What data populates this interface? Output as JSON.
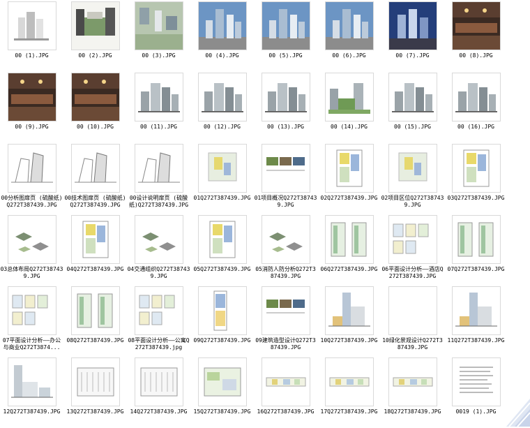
{
  "files": [
    {
      "name": "00 (1).JPG",
      "kind": "white-towers"
    },
    {
      "name": "00 (2).JPG",
      "kind": "plaza"
    },
    {
      "name": "00 (3).JPG",
      "kind": "aerial"
    },
    {
      "name": "00 (4).JPG",
      "kind": "towers-sky"
    },
    {
      "name": "00 (5).JPG",
      "kind": "towers-sky"
    },
    {
      "name": "00 (6).JPG",
      "kind": "towers-sky"
    },
    {
      "name": "00 (7).JPG",
      "kind": "towers-dusk"
    },
    {
      "name": "00 (8).JPG",
      "kind": "interior"
    },
    {
      "name": "00 (9).JPG",
      "kind": "interior"
    },
    {
      "name": "00 (10).JPG",
      "kind": "interior"
    },
    {
      "name": "00 (11).JPG",
      "kind": "grey-towers"
    },
    {
      "name": "00 (12).JPG",
      "kind": "grey-towers"
    },
    {
      "name": "00 (13).JPG",
      "kind": "grey-towers"
    },
    {
      "name": "00 (14).JPG",
      "kind": "green-towers"
    },
    {
      "name": "00 (15).JPG",
      "kind": "grey-towers"
    },
    {
      "name": "00 (16).JPG",
      "kind": "grey-towers"
    },
    {
      "name": "00分析图扉页 (硫酸纸)Q272T387439.JPG",
      "kind": "sketch"
    },
    {
      "name": "00技术图扉页 (硫酸纸)Q272T387439.JPG",
      "kind": "sketch"
    },
    {
      "name": "00设计说明扉页 (硫酸纸)Q272T387439.JPG",
      "kind": "sketch"
    },
    {
      "name": "01Q272T387439.JPG",
      "kind": "siteplan"
    },
    {
      "name": "01项目概况Q272T387439.JPG",
      "kind": "photos"
    },
    {
      "name": "02Q272T387439.JPG",
      "kind": "floorplan"
    },
    {
      "name": "02项目区位Q272T387439.JPG",
      "kind": "siteplan"
    },
    {
      "name": "03Q272T387439.JPG",
      "kind": "floorplan"
    },
    {
      "name": "03总体布局Q272T387439.JPG",
      "kind": "axon"
    },
    {
      "name": "04Q272T387439.JPG",
      "kind": "floorplan"
    },
    {
      "name": "04交通组织Q272T387439.JPG",
      "kind": "axon"
    },
    {
      "name": "05Q272T387439.JPG",
      "kind": "floorplan"
    },
    {
      "name": "05消防人防分析Q272T387439.JPG",
      "kind": "axon"
    },
    {
      "name": "06Q272T387439.JPG",
      "kind": "twoplans"
    },
    {
      "name": "06平面设计分析——酒店Q272T387439.JPG",
      "kind": "planset"
    },
    {
      "name": "07Q272T387439.JPG",
      "kind": "twoplans"
    },
    {
      "name": "07平面设计分析——办公与商业Q272T3874...",
      "kind": "planset"
    },
    {
      "name": "08Q272T387439.JPG",
      "kind": "twoplans"
    },
    {
      "name": "08平面设计分析——公寓Q272T387439.jpg",
      "kind": "planset"
    },
    {
      "name": "09Q272T387439.JPG",
      "kind": "tallplan"
    },
    {
      "name": "09建筑造型设计Q272T387439.JPG",
      "kind": "photos"
    },
    {
      "name": "10Q272T387439.JPG",
      "kind": "elevation"
    },
    {
      "name": "10绿化景观设计Q272T387439.JPG",
      "kind": "landscape"
    },
    {
      "name": "11Q272T387439.JPG",
      "kind": "elevation"
    },
    {
      "name": "12Q272T387439.JPG",
      "kind": "elevation-left"
    },
    {
      "name": "13Q272T387439.JPG",
      "kind": "parking"
    },
    {
      "name": "14Q272T387439.JPG",
      "kind": "parking"
    },
    {
      "name": "15Q272T387439.JPG",
      "kind": "parking-green"
    },
    {
      "name": "16Q272T387439.JPG",
      "kind": "section"
    },
    {
      "name": "17Q272T387439.JPG",
      "kind": "section"
    },
    {
      "name": "18Q272T387439.JPG",
      "kind": "section"
    },
    {
      "name": "0019 (1).JPG",
      "kind": "text-doc"
    }
  ]
}
